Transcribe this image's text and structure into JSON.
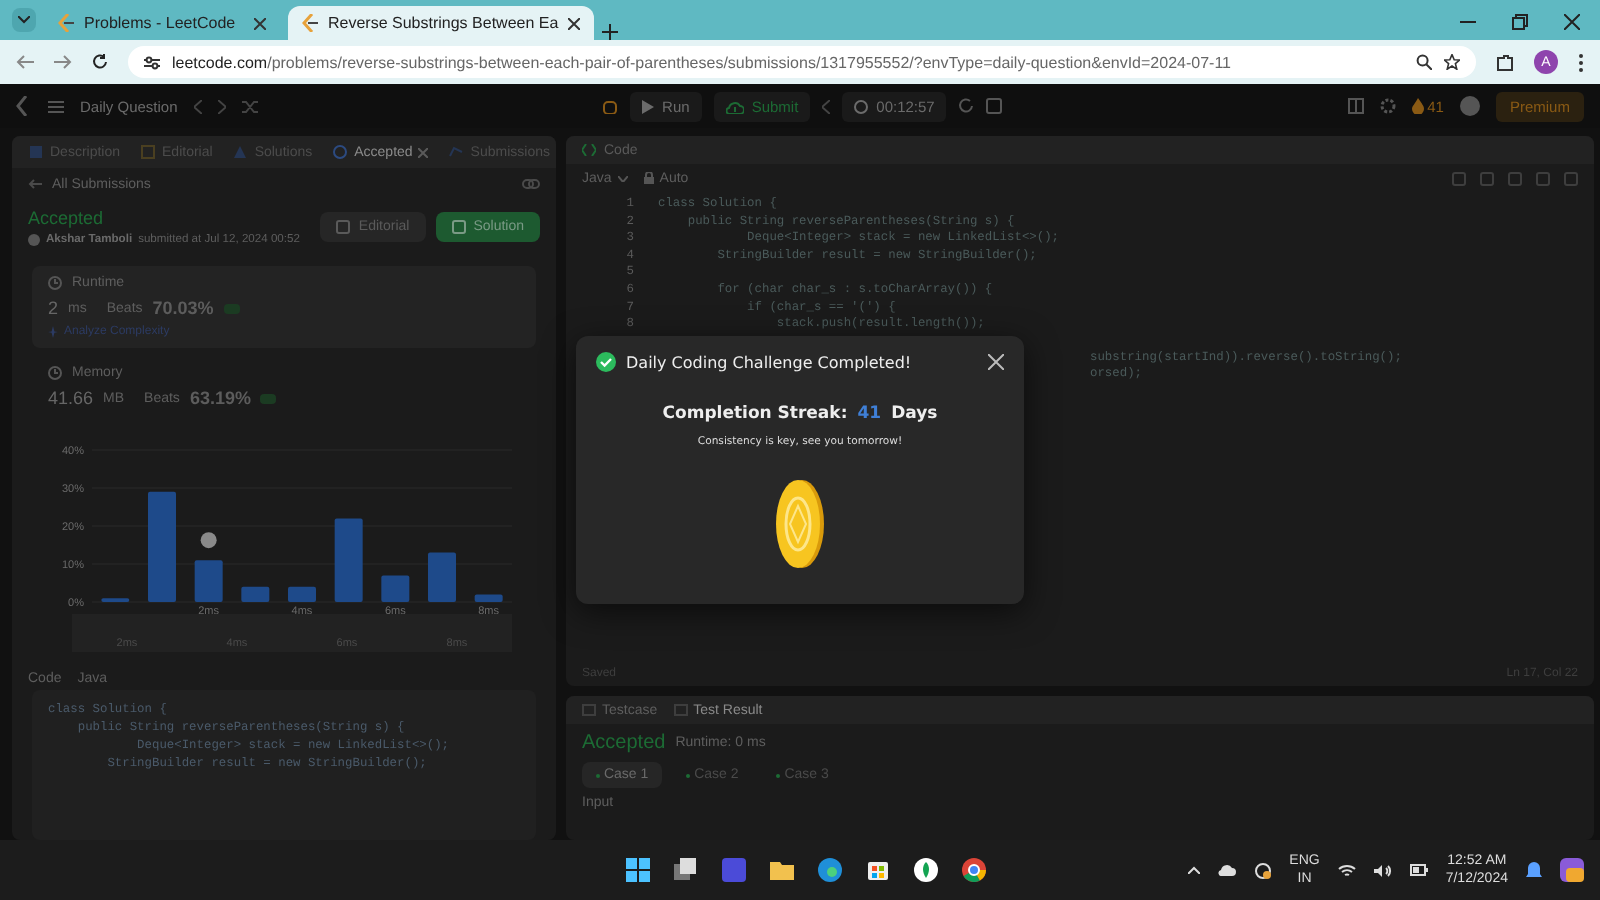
{
  "browser": {
    "tabs": [
      {
        "title": "Problems - LeetCode",
        "selected": false
      },
      {
        "title": "Reverse Substrings Between Ea",
        "selected": true
      }
    ],
    "url_domain": "leetcode.com",
    "url_path": "/problems/reverse-substrings-between-each-pair-of-parentheses/submissions/1317955552/?envType=daily-question&envId=2024-07-11",
    "profile": "A"
  },
  "nav": {
    "title": "Daily Question",
    "run": "Run",
    "submit": "Submit",
    "timer": "00:12:57",
    "streak": "41",
    "premium": "Premium"
  },
  "left": {
    "tabs": [
      {
        "label": "Description",
        "selected": false,
        "closable": false
      },
      {
        "label": "Editorial",
        "selected": false,
        "closable": false
      },
      {
        "label": "Solutions",
        "selected": false,
        "closable": false
      },
      {
        "label": "Accepted",
        "selected": true,
        "closable": true
      },
      {
        "label": "Submissions",
        "selected": false,
        "closable": false
      }
    ],
    "back": "All Submissions",
    "status": "Accepted",
    "author": "Akshar Tamboli",
    "submitted": "submitted at Jul 12, 2024 00:52",
    "buttons": [
      {
        "label": "Editorial",
        "kind": "secondary"
      },
      {
        "label": "Solution",
        "kind": "primary"
      }
    ],
    "runtime": {
      "label": "Runtime",
      "value": "2",
      "unit": "ms",
      "beats_label": "Beats",
      "beats": "70.03%",
      "link": "Analyze Complexity"
    },
    "memory": {
      "label": "Memory",
      "value": "41.66",
      "unit": "MB",
      "beats_label": "Beats",
      "beats": "63.19%"
    },
    "chart_data": {
      "type": "bar",
      "x": [
        0,
        1,
        2,
        3,
        4,
        5,
        6,
        7,
        8
      ],
      "xlim": [
        -0.5,
        8.5
      ],
      "grid": true,
      "values": [
        1,
        29,
        11,
        4,
        4,
        22,
        7,
        13,
        2
      ],
      "ylim": [
        0,
        40
      ],
      "yticks": [
        {
          "value": 0,
          "label": "0%"
        },
        {
          "value": 10,
          "label": "10%"
        },
        {
          "value": 20,
          "label": "20%"
        },
        {
          "value": 30,
          "label": "30%"
        },
        {
          "value": 40,
          "label": "40%"
        }
      ],
      "xticks": [
        {
          "value": 2,
          "label": "2ms"
        },
        {
          "value": 4,
          "label": "4ms"
        },
        {
          "value": 6,
          "label": "6ms"
        },
        {
          "value": 8,
          "label": "8ms"
        }
      ]
    },
    "navigator_labels": [
      "2ms",
      "4ms",
      "6ms",
      "8ms"
    ],
    "code_label": "Code",
    "language": "Java",
    "code": [
      "class Solution {",
      "    public String reverseParentheses(String s) {",
      "            Deque<Integer> stack = new LinkedList<>();",
      "        StringBuilder result = new StringBuilder();"
    ]
  },
  "editor": {
    "title": "Code",
    "language": "Java",
    "mode": "Auto",
    "lines": [
      {
        "number": "1",
        "text": "class Solution {"
      },
      {
        "number": "2",
        "text": "    public String reverseParentheses(String s) {"
      },
      {
        "number": "3",
        "text": "            Deque<Integer> stack = new LinkedList<>();"
      },
      {
        "number": "4",
        "text": "        StringBuilder result = new StringBuilder();"
      },
      {
        "number": "5"
      },
      {
        "number": "6",
        "text": "        for (char char_s : s.toCharArray()) {"
      },
      {
        "number": "7",
        "text": "            if (char_s == '(') {"
      },
      {
        "number": "8",
        "text": "                stack.push(result.length());"
      }
    ],
    "fragments": [
      "substring(startInd)).reverse().toString();",
      "orsed);"
    ],
    "status": "Saved",
    "cursor": "Ln 17, Col 22"
  },
  "results": {
    "tabs": [
      {
        "label": "Testcase",
        "selected": false
      },
      {
        "label": "Test Result",
        "selected": true
      }
    ],
    "status": "Accepted",
    "runtime": "Runtime: 0 ms",
    "cases": [
      {
        "label": "Case 1",
        "selected": true
      },
      {
        "label": "Case 2",
        "selected": false
      },
      {
        "label": "Case 3",
        "selected": false
      }
    ],
    "input_label": "Input"
  },
  "modal": {
    "title": "Daily Coding Challenge Completed!",
    "streak_label": "Completion Streak:",
    "streak": "41",
    "streak_unit": "Days",
    "message": "Consistency is key, see you tomorrow!"
  },
  "taskbar": {
    "language": "ENG",
    "region": "IN",
    "time": "12:52 AM",
    "date": "7/12/2024"
  }
}
